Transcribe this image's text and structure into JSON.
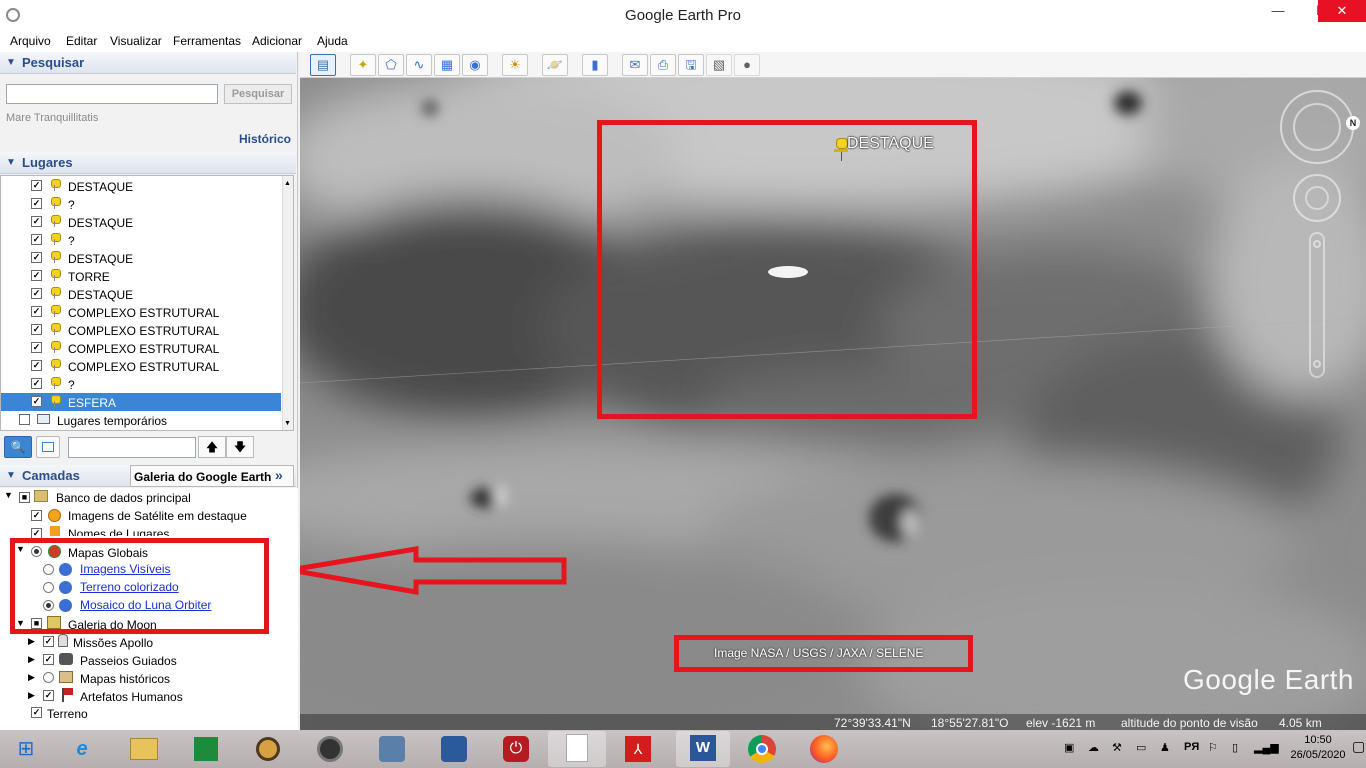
{
  "window": {
    "title": "Google Earth Pro",
    "minimize": "—",
    "maximize": "☐",
    "close": "✕"
  },
  "menu": [
    "Arquivo",
    "Editar",
    "Visualizar",
    "Ferramentas",
    "Adicionar",
    "Ajuda"
  ],
  "search": {
    "header": "Pesquisar",
    "input_value": "",
    "button": "Pesquisar",
    "hint": "Mare Tranquillitatis",
    "history_link": "Histórico"
  },
  "places": {
    "header": "Lugares",
    "items": [
      {
        "label": "DESTAQUE",
        "checked": true
      },
      {
        "label": "?",
        "checked": true
      },
      {
        "label": "DESTAQUE",
        "checked": true
      },
      {
        "label": "?",
        "checked": true
      },
      {
        "label": "DESTAQUE",
        "checked": true
      },
      {
        "label": "TORRE",
        "checked": true
      },
      {
        "label": "DESTAQUE",
        "checked": true
      },
      {
        "label": "COMPLEXO ESTRUTURAL",
        "checked": true
      },
      {
        "label": "COMPLEXO ESTRUTURAL",
        "checked": true
      },
      {
        "label": "COMPLEXO ESTRUTURAL",
        "checked": true
      },
      {
        "label": "COMPLEXO ESTRUTURAL",
        "checked": true
      },
      {
        "label": "?",
        "checked": true
      },
      {
        "label": "ESFERA",
        "checked": true,
        "selected": true
      }
    ],
    "temp_folder": "Lugares temporários",
    "selected_color": "#3b86d4"
  },
  "layers": {
    "header": "Camadas",
    "gallery_button": "Galeria do Google Earth",
    "db": "Banco de dados principal",
    "items": {
      "sat": "Imagens de Satélite em destaque",
      "names": "Nomes de Lugares",
      "global": "Mapas Globais",
      "visible": "Imagens Visíveis",
      "color": "Terreno colorizado",
      "luna": "Mosaico do Luna Orbiter",
      "moon_gallery": "Galeria do Moon",
      "apollo": "Missões Apollo",
      "tours": "Passeios Guiados",
      "hist": "Mapas históricos",
      "artifacts": "Artefatos Humanos",
      "terrain": "Terreno"
    }
  },
  "map": {
    "placemark_label": "DESTAQUE",
    "attribution": "Image NASA / USGS / JAXA / SELENE",
    "logo": "Google Earth",
    "status": {
      "lat": "72°39'33.41\"N",
      "lon": "18°55'27.81\"O",
      "elev": "elev -1621 m",
      "eye": "altitude do ponto de visão",
      "eye_val": "4.05 km"
    },
    "annotation_color": "#e4151c"
  },
  "taskbar": {
    "time": "10:50",
    "date": "26/05/2020",
    "apps": [
      "windows-start",
      "internet-explorer",
      "file-explorer",
      "excel-green",
      "disk-utility",
      "speaker-app",
      "doc-app",
      "editor-app",
      "power-app",
      "blank-doc",
      "pdf-reader",
      "word",
      "chrome",
      "firefox"
    ]
  }
}
